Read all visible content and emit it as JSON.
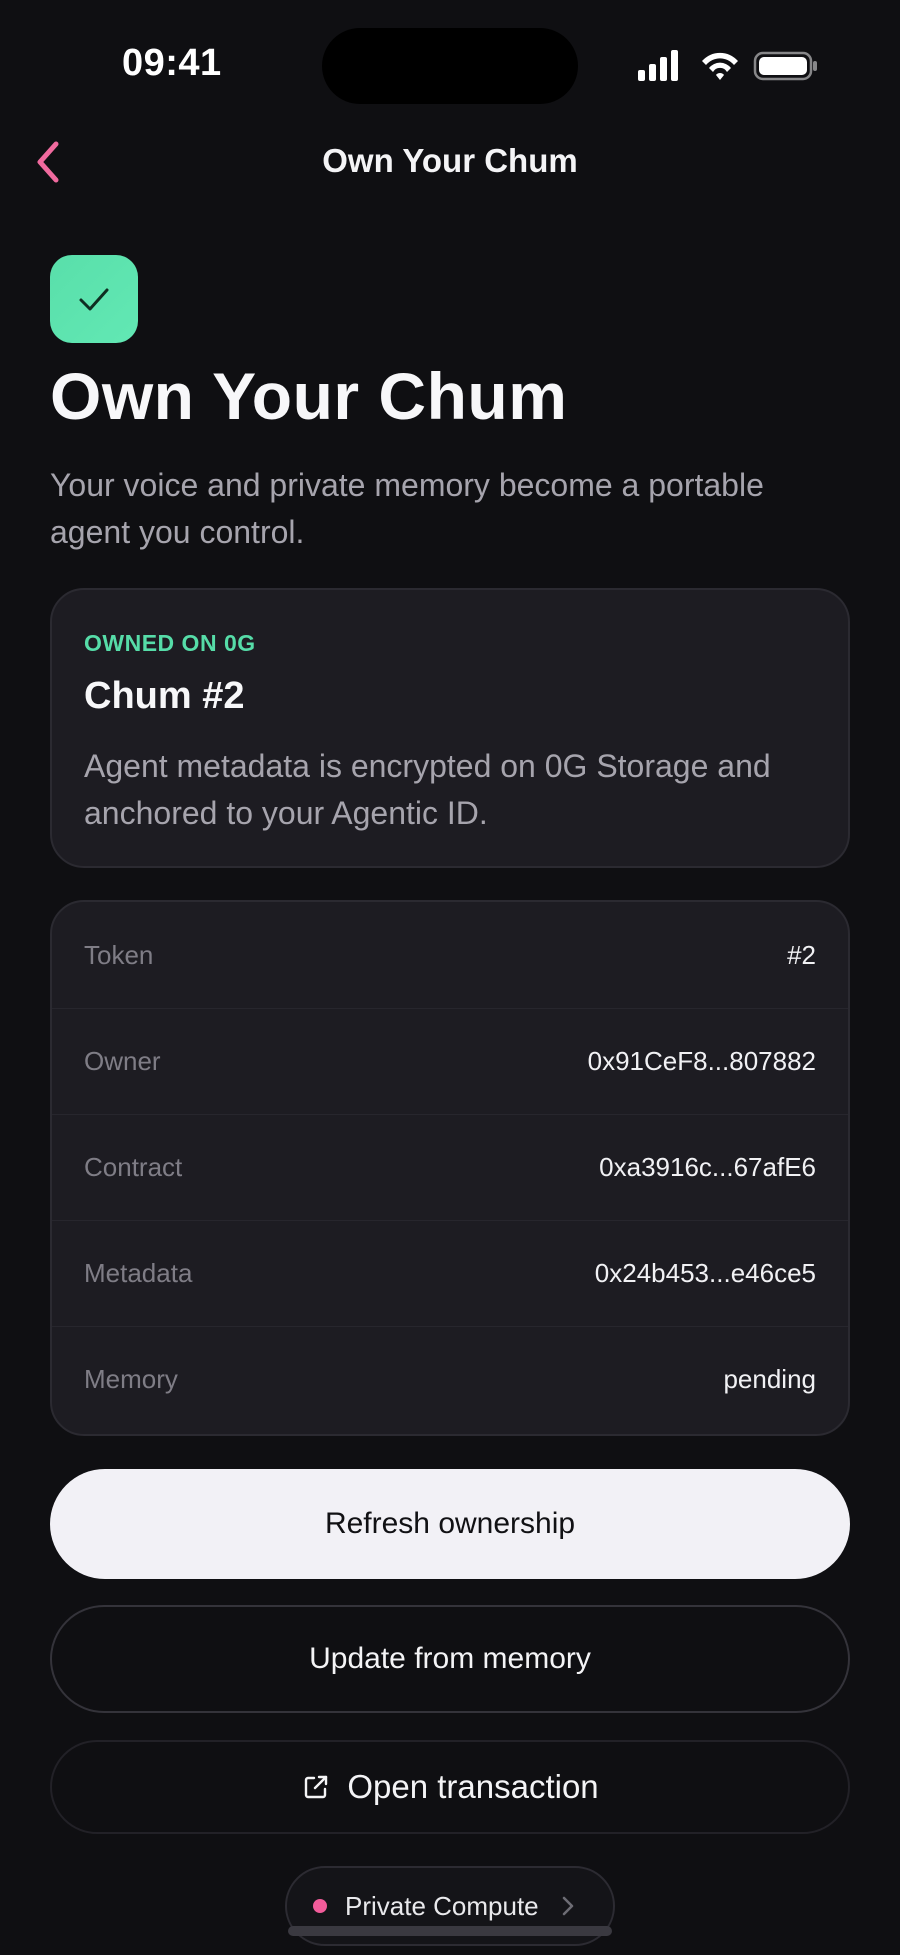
{
  "status_bar": {
    "time": "09:41"
  },
  "nav": {
    "title": "Own Your Chum",
    "back_icon": "chevron-left-icon",
    "accent_color": "#f06a9e"
  },
  "hero": {
    "badge_icon": "checkmark-icon",
    "badge_color": "#5ce3ad",
    "title": "Own Your Chum",
    "subtitle": "Your voice and private memory become a portable agent you control."
  },
  "owned_card": {
    "eyebrow": "OWNED ON 0G",
    "eyebrow_color": "#56dca8",
    "name": "Chum #2",
    "description": "Agent metadata is encrypted on 0G Storage and anchored to your Agentic ID."
  },
  "details": [
    {
      "label": "Token",
      "value": "#2"
    },
    {
      "label": "Owner",
      "value": "0x91CeF8...807882"
    },
    {
      "label": "Contract",
      "value": "0xa3916c...67afE6"
    },
    {
      "label": "Metadata",
      "value": "0x24b453...e46ce5"
    },
    {
      "label": "Memory",
      "value": "pending"
    }
  ],
  "actions": {
    "refresh_label": "Refresh ownership",
    "update_label": "Update from memory",
    "open_tx_label": "Open transaction",
    "open_tx_icon": "external-link-icon"
  },
  "private_compute": {
    "label": "Private Compute",
    "dot_color": "#f25c9a"
  }
}
